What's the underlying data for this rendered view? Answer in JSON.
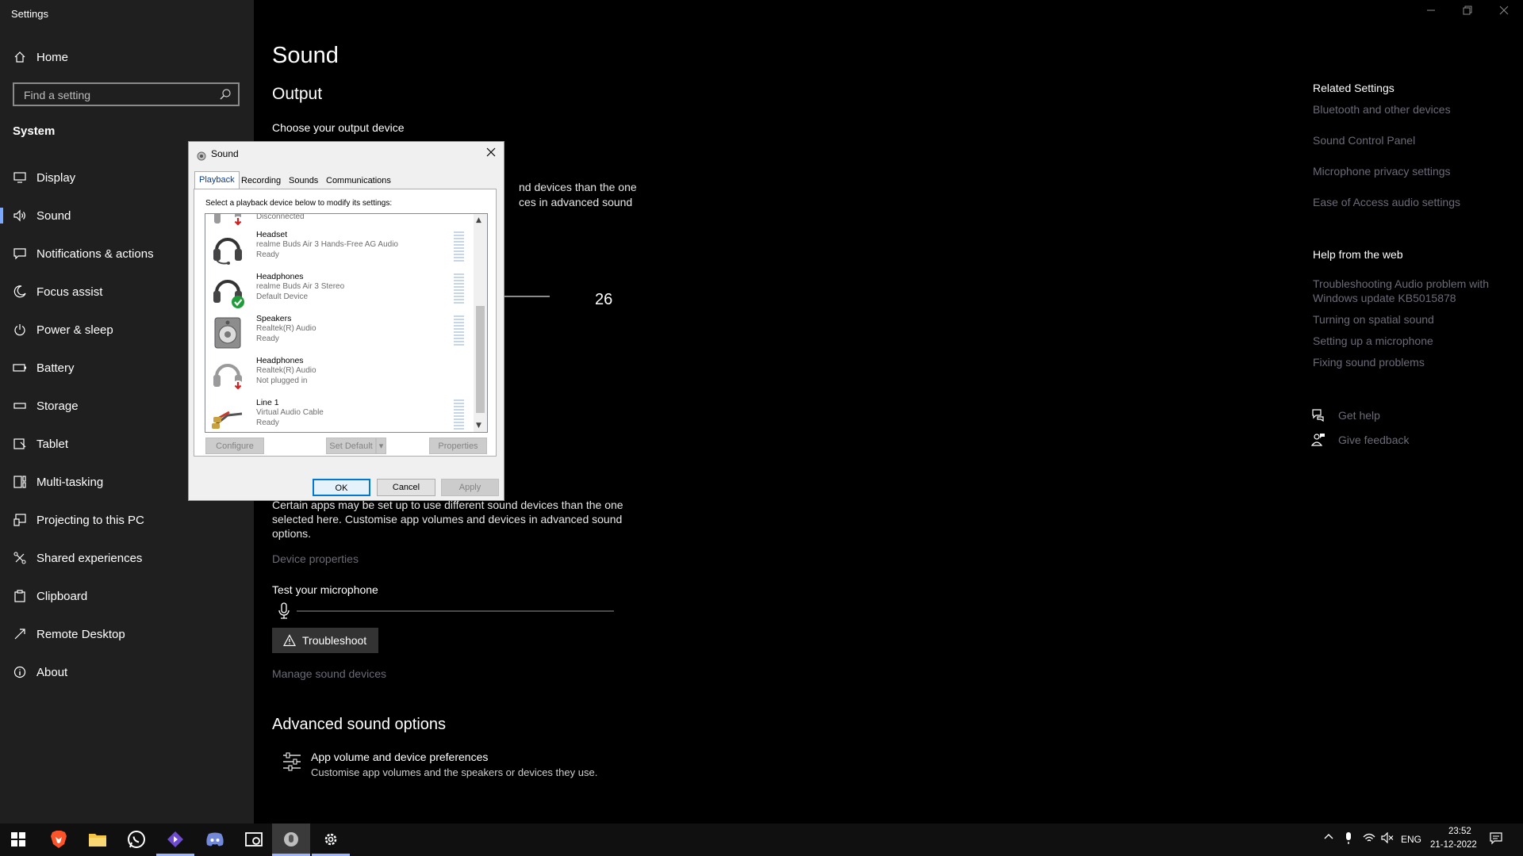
{
  "app": {
    "title": "Settings"
  },
  "sidebar": {
    "home_label": "Home",
    "search_placeholder": "Find a setting",
    "section_label": "System",
    "items": [
      {
        "label": "Display",
        "icon": "display-icon"
      },
      {
        "label": "Sound",
        "icon": "speaker-icon",
        "active": true
      },
      {
        "label": "Notifications & actions",
        "icon": "notification-icon"
      },
      {
        "label": "Focus assist",
        "icon": "moon-icon"
      },
      {
        "label": "Power & sleep",
        "icon": "power-icon"
      },
      {
        "label": "Battery",
        "icon": "battery-icon"
      },
      {
        "label": "Storage",
        "icon": "storage-icon"
      },
      {
        "label": "Tablet",
        "icon": "tablet-icon"
      },
      {
        "label": "Multi-tasking",
        "icon": "multitask-icon"
      },
      {
        "label": "Projecting to this PC",
        "icon": "projector-icon"
      },
      {
        "label": "Shared experiences",
        "icon": "shared-icon"
      },
      {
        "label": "Clipboard",
        "icon": "clipboard-icon"
      },
      {
        "label": "Remote Desktop",
        "icon": "remote-icon"
      },
      {
        "label": "About",
        "icon": "info-icon"
      }
    ]
  },
  "main": {
    "title": "Sound",
    "output_heading": "Output",
    "choose_output_label": "Choose your output device",
    "output_para_fragment_1": "nd devices than the one",
    "output_para_fragment_2": "ces in advanced sound",
    "volume_value": "26",
    "input_para": "Certain apps may be set up to use different sound devices than the one selected here. Customise app volumes and devices in advanced sound options.",
    "device_properties_link": "Device properties",
    "test_mic_label": "Test your microphone",
    "troubleshoot_label": "Troubleshoot",
    "manage_devices_link": "Manage sound devices",
    "advanced_heading": "Advanced sound options",
    "app_volume_title": "App volume and device preferences",
    "app_volume_desc": "Customise app volumes and the speakers or devices they use."
  },
  "related": {
    "heading": "Related Settings",
    "links": [
      "Bluetooth and other devices",
      "Sound Control Panel",
      "Microphone privacy settings",
      "Ease of Access audio settings"
    ]
  },
  "help_web": {
    "heading": "Help from the web",
    "links": [
      "Troubleshooting Audio problem with Windows update KB5015878",
      "Turning on spatial sound",
      "Setting up a microphone",
      "Fixing sound problems"
    ],
    "get_help": "Get help",
    "give_feedback": "Give feedback"
  },
  "dialog": {
    "title": "Sound",
    "tabs": [
      "Playback",
      "Recording",
      "Sounds",
      "Communications"
    ],
    "active_tab": "Playback",
    "instruction": "Select a playback device below to modify its settings:",
    "devices": [
      {
        "name": "",
        "desc": "",
        "status": "Disconnected",
        "icon": "headset-disconnected-icon"
      },
      {
        "name": "Headset",
        "desc": "realme Buds Air 3 Hands-Free AG Audio",
        "status": "Ready",
        "icon": "headset-icon"
      },
      {
        "name": "Headphones",
        "desc": "realme Buds Air 3 Stereo",
        "status": "Default Device",
        "icon": "headphones-default-icon"
      },
      {
        "name": "Speakers",
        "desc": "Realtek(R) Audio",
        "status": "Ready",
        "icon": "speakers-icon"
      },
      {
        "name": "Headphones",
        "desc": "Realtek(R) Audio",
        "status": "Not plugged in",
        "icon": "headphones-unplugged-icon"
      },
      {
        "name": "Line 1",
        "desc": "Virtual Audio Cable",
        "status": "Ready",
        "icon": "cable-icon"
      }
    ],
    "buttons": {
      "configure": "Configure",
      "set_default": "Set Default",
      "properties": "Properties",
      "ok": "OK",
      "cancel": "Cancel",
      "apply": "Apply"
    }
  },
  "taskbar": {
    "language": "ENG",
    "time": "23:52",
    "date": "21-12-2022"
  },
  "colors": {
    "accent": "#7aa7ff",
    "sidebar_bg": "#1f1f1f",
    "link": "#6b6b78",
    "dialog_default_border": "#0078d7"
  }
}
